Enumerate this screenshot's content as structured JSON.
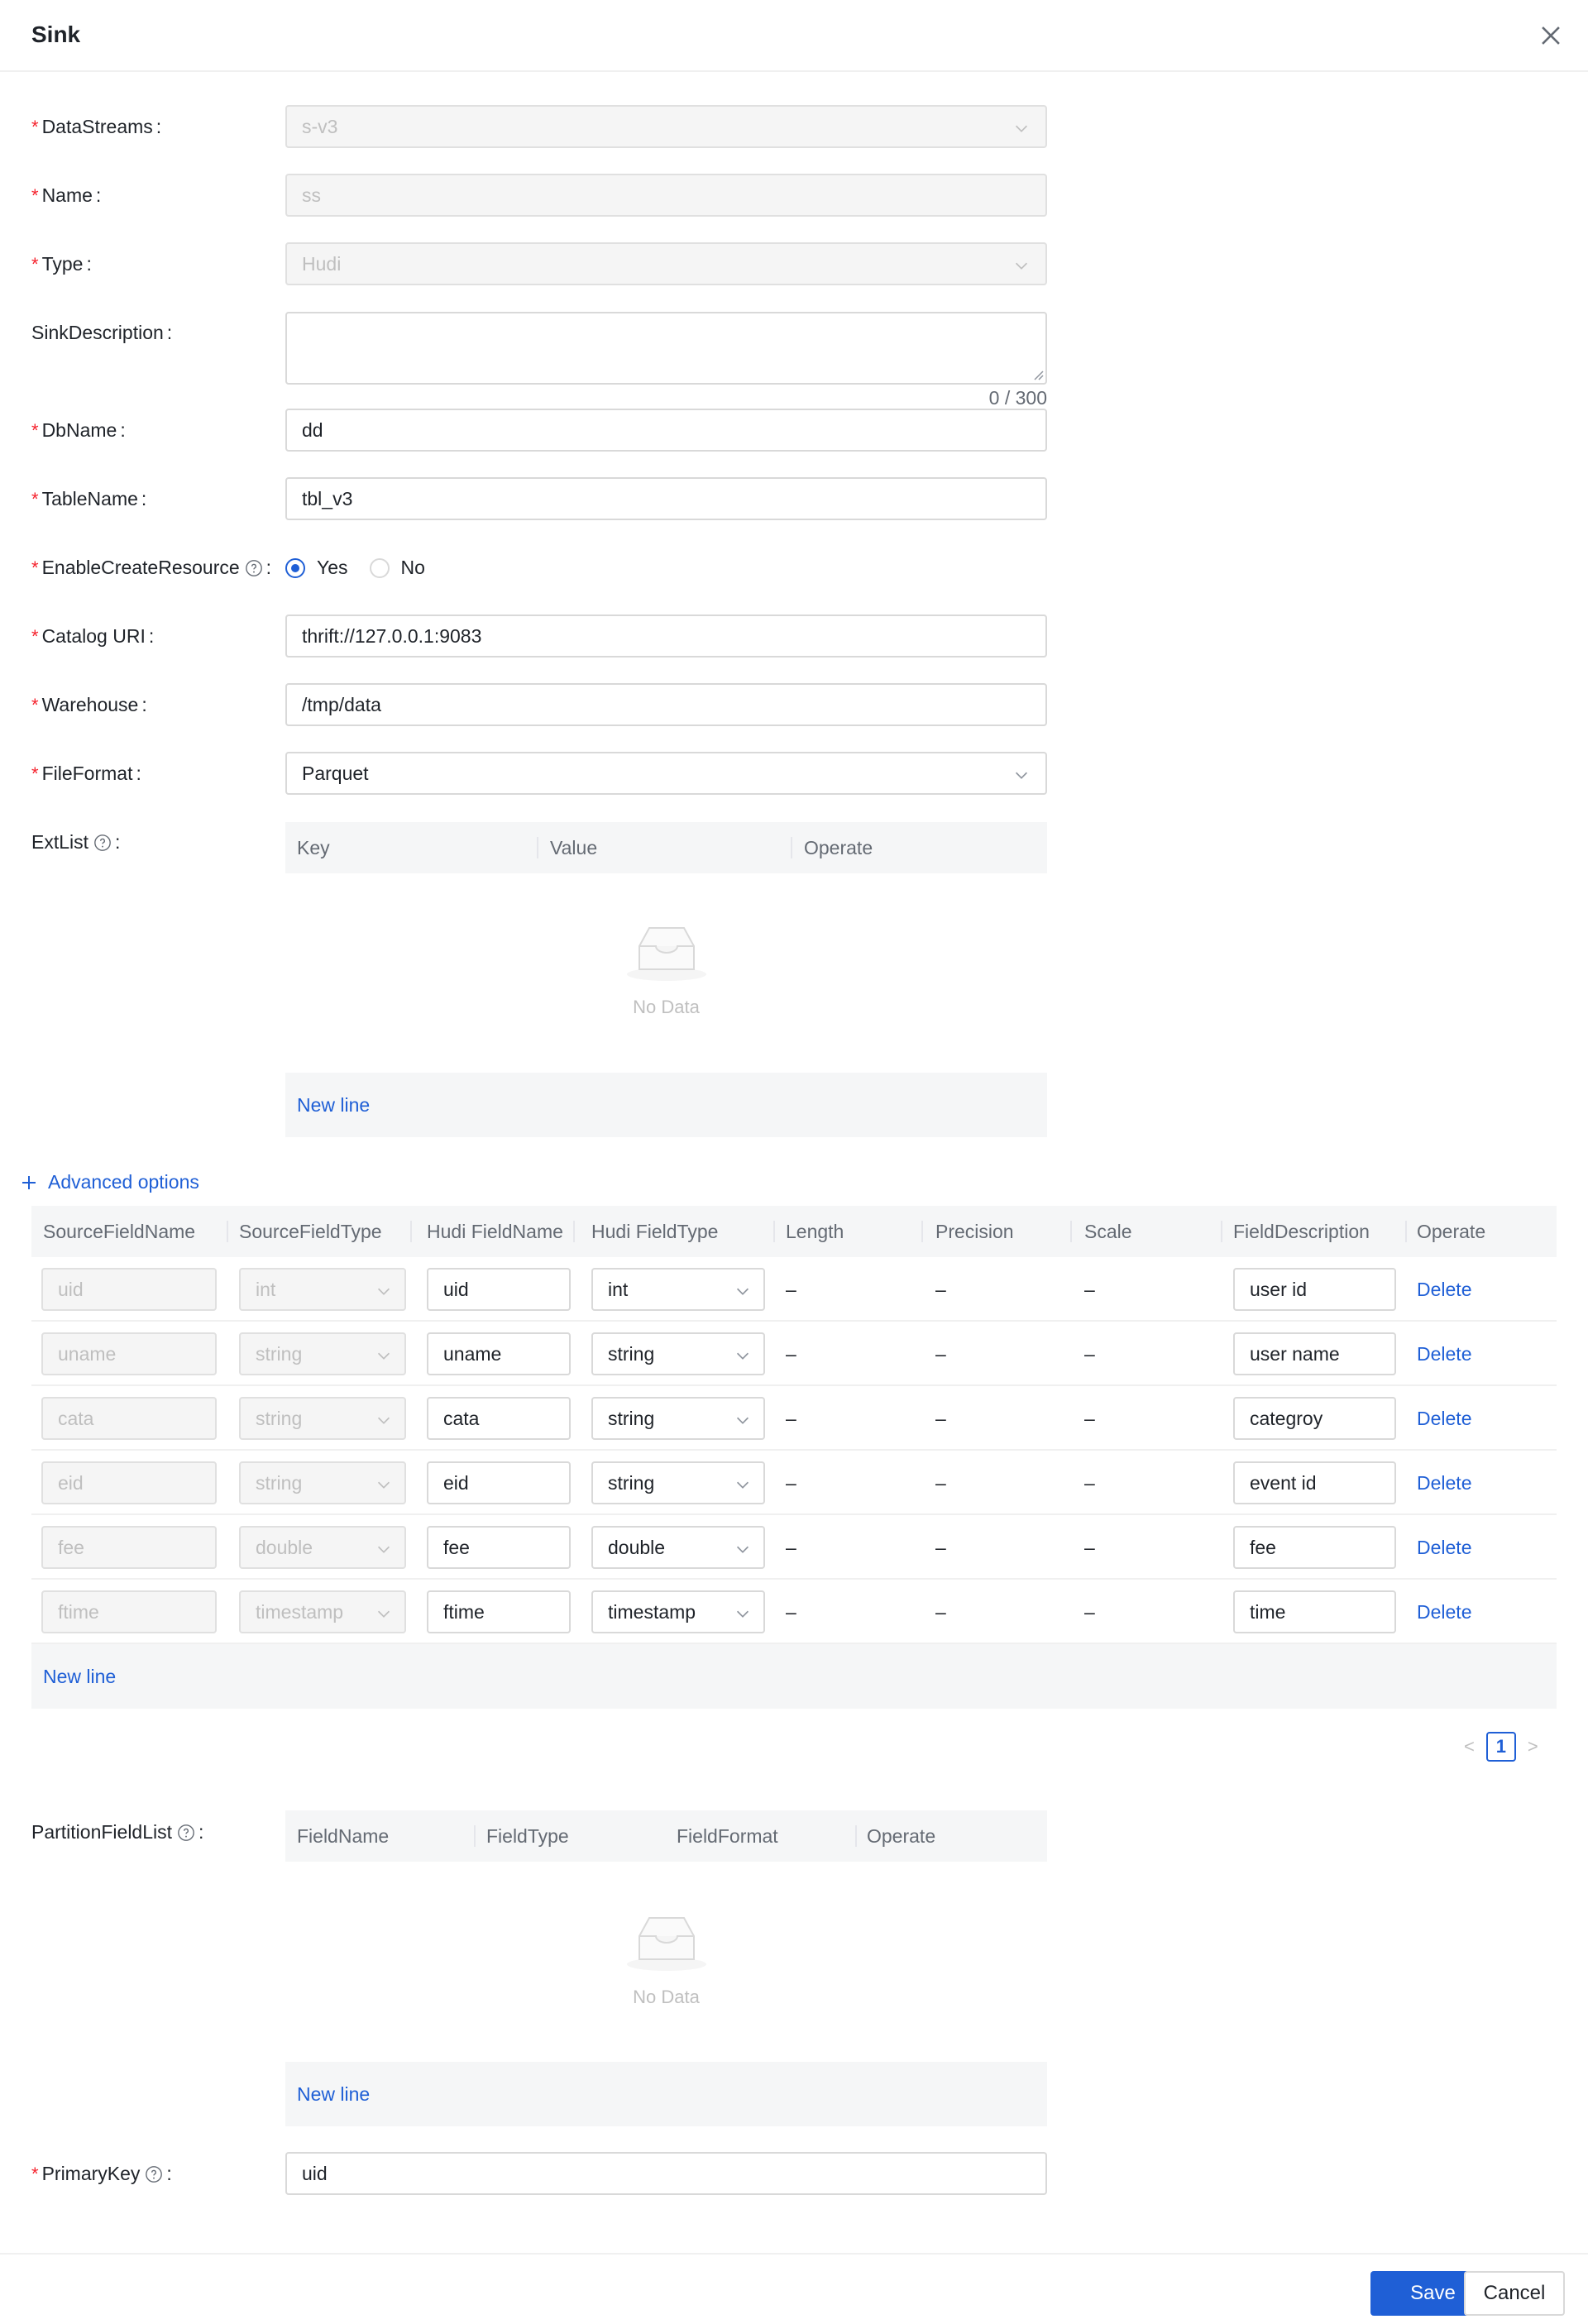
{
  "header": {
    "title": "Sink"
  },
  "form": {
    "datastreams": {
      "label": "DataStreams",
      "value": "s-v3"
    },
    "name": {
      "label": "Name",
      "value": "ss"
    },
    "type": {
      "label": "Type",
      "value": "Hudi"
    },
    "sink_description": {
      "label": "SinkDescription",
      "value": "",
      "counter": "0 / 300"
    },
    "db_name": {
      "label": "DbName",
      "value": "dd"
    },
    "table_name": {
      "label": "TableName",
      "value": "tbl_v3"
    },
    "enable_create_resource": {
      "label": "EnableCreateResource",
      "options": [
        "Yes",
        "No"
      ],
      "selected": "Yes"
    },
    "catalog_uri": {
      "label": "Catalog URI",
      "value": "thrift://127.0.0.1:9083"
    },
    "warehouse": {
      "label": "Warehouse",
      "value": "/tmp/data"
    },
    "file_format": {
      "label": "FileFormat",
      "value": "Parquet"
    },
    "ext_list": {
      "label": "ExtList",
      "columns": [
        "Key",
        "Value",
        "Operate"
      ],
      "empty_text": "No Data",
      "new_line": "New line"
    },
    "advanced_options": "Advanced options",
    "fields_table": {
      "columns": [
        "SourceFieldName",
        "SourceFieldType",
        "Hudi FieldName",
        "Hudi FieldType",
        "Length",
        "Precision",
        "Scale",
        "FieldDescription",
        "Operate"
      ],
      "rows": [
        {
          "source_name": "uid",
          "source_type": "int",
          "hudi_name": "uid",
          "hudi_type": "int",
          "length": "–",
          "precision": "–",
          "scale": "–",
          "description": "user id",
          "action": "Delete"
        },
        {
          "source_name": "uname",
          "source_type": "string",
          "hudi_name": "uname",
          "hudi_type": "string",
          "length": "–",
          "precision": "–",
          "scale": "–",
          "description": "user name",
          "action": "Delete"
        },
        {
          "source_name": "cata",
          "source_type": "string",
          "hudi_name": "cata",
          "hudi_type": "string",
          "length": "–",
          "precision": "–",
          "scale": "–",
          "description": "categroy",
          "action": "Delete"
        },
        {
          "source_name": "eid",
          "source_type": "string",
          "hudi_name": "eid",
          "hudi_type": "string",
          "length": "–",
          "precision": "–",
          "scale": "–",
          "description": "event id",
          "action": "Delete"
        },
        {
          "source_name": "fee",
          "source_type": "double",
          "hudi_name": "fee",
          "hudi_type": "double",
          "length": "–",
          "precision": "–",
          "scale": "–",
          "description": "fee",
          "action": "Delete"
        },
        {
          "source_name": "ftime",
          "source_type": "timestamp",
          "hudi_name": "ftime",
          "hudi_type": "timestamp",
          "length": "–",
          "precision": "–",
          "scale": "–",
          "description": "time",
          "action": "Delete"
        }
      ],
      "new_line": "New line",
      "pagination": {
        "current_page": "1",
        "prev": "<",
        "next": ">"
      }
    },
    "partition_field_list": {
      "label": "PartitionFieldList",
      "columns": [
        "FieldName",
        "FieldType",
        "FieldFormat",
        "Operate"
      ],
      "empty_text": "No Data",
      "new_line": "New line"
    },
    "primary_key": {
      "label": "PrimaryKey",
      "value": "uid"
    }
  },
  "footer": {
    "save": "Save",
    "cancel": "Cancel"
  },
  "colors": {
    "primary": "#1f5fd6",
    "required": "#f5222d",
    "header_bg": "#f5f6f7"
  }
}
